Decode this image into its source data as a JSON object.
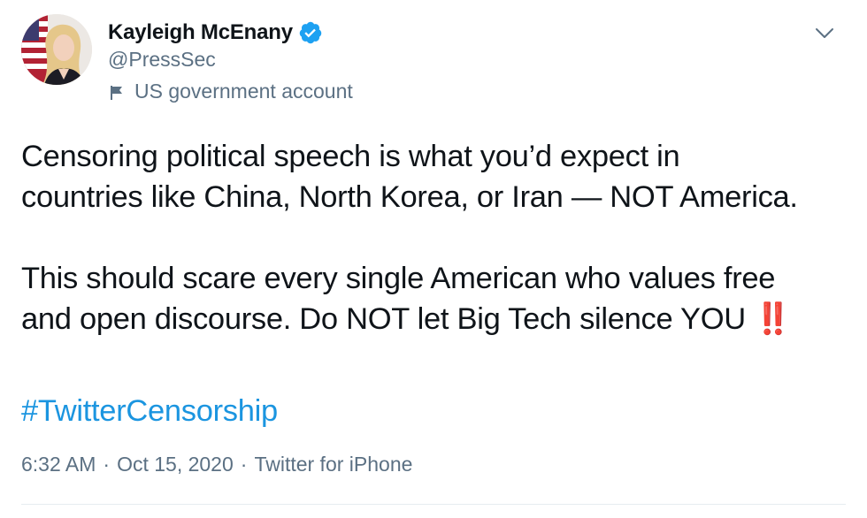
{
  "author": {
    "display_name": "Kayleigh McEnany",
    "handle": "@PressSec",
    "verified": true,
    "account_label": "US government account"
  },
  "tweet": {
    "lines": [
      "Censoring political speech is what you’d expect in",
      "countries like China, North Korea, or Iran — NOT America.",
      "",
      "This should scare every single American who values free",
      "and open discourse. Do NOT let Big Tech silence YOU"
    ],
    "emoji": "‼️",
    "hashtag": "#TwitterCensorship"
  },
  "meta": {
    "time": "6:32 AM",
    "date": "Oct 15, 2020",
    "source": "Twitter for iPhone",
    "separator": "·"
  },
  "colors": {
    "text": "#0f1419",
    "secondary": "#5b7083",
    "link": "#1b95e0",
    "verified": "#1da1f2",
    "emoji": "#d7191c"
  },
  "icons": {
    "verified": "verified-badge-icon",
    "flag": "flag-icon",
    "menu": "chevron-down-icon"
  }
}
